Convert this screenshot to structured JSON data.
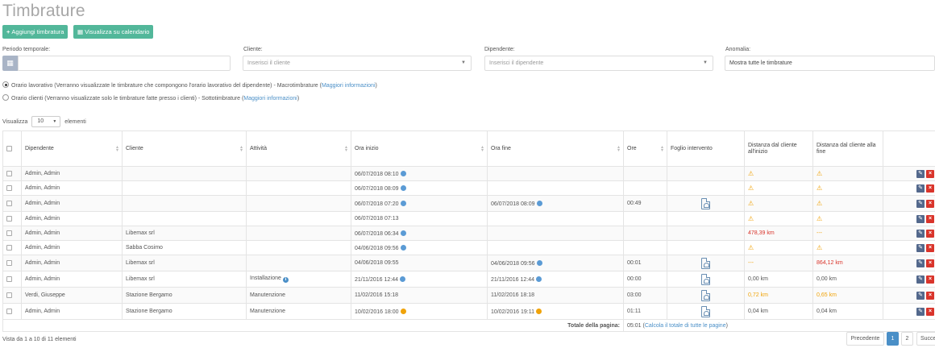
{
  "page": {
    "title": "Timbrature"
  },
  "toolbar": {
    "add_label": "Aggiungi timbratura",
    "calendar_label": "Visualizza su calendario"
  },
  "filters": {
    "period_label": "Periodo temporale:",
    "client_label": "Cliente:",
    "client_placeholder": "Inserisci il cliente",
    "employee_label": "Dipendente:",
    "employee_placeholder": "Inserisci il dipendente",
    "anomaly_label": "Anomalia:",
    "anomaly_value": "Mostra tutte le timbrature"
  },
  "radios": [
    {
      "label": "Orario lavorativo (Verranno visualizzate le timbrature che compongono l'orario lavorativo del dipendente) - Macrotimbrature (",
      "link": "Maggiori informazioni",
      "suffix": ")",
      "checked": true
    },
    {
      "label": "Orario clienti (Verranno visualizzate solo le timbrature fatte presso i clienti) - Sottotimbrature (",
      "link": "Maggiori informazioni",
      "suffix": ")",
      "checked": false
    }
  ],
  "length": {
    "prefix": "Visualizza",
    "value": "10",
    "suffix": "elementi"
  },
  "table": {
    "headers": {
      "employee": "Dipendente",
      "client": "Cliente",
      "activity": "Attività",
      "start": "Ora inizio",
      "end": "Ora fine",
      "hours": "Ore",
      "sheet": "Foglio intervento",
      "dist_start": "Distanza dal cliente all'inizio",
      "dist_end": "Distanza dal cliente alla fine"
    },
    "rows": [
      {
        "employee": "Admin, Admin",
        "client": "",
        "activity": "",
        "start": "06/07/2018 08:10",
        "start_icon": "globe-icon",
        "end": "",
        "end_icon": "",
        "hours": "",
        "pdf": false,
        "dist_start": "",
        "dist_start_kind": "warn",
        "dist_end": "",
        "dist_end_kind": "warn"
      },
      {
        "employee": "Admin, Admin",
        "client": "",
        "activity": "",
        "start": "06/07/2018 08:09",
        "start_icon": "globe-icon",
        "end": "",
        "end_icon": "",
        "hours": "",
        "pdf": false,
        "dist_start": "",
        "dist_start_kind": "warn",
        "dist_end": "",
        "dist_end_kind": "warn"
      },
      {
        "employee": "Admin, Admin",
        "client": "",
        "activity": "",
        "start": "06/07/2018 07:20",
        "start_icon": "globe-icon",
        "end": "06/07/2018 08:09",
        "end_icon": "globe-icon",
        "hours": "00:49",
        "pdf": true,
        "dist_start": "",
        "dist_start_kind": "warn",
        "dist_end": "",
        "dist_end_kind": "warn"
      },
      {
        "employee": "Admin, Admin",
        "client": "",
        "activity": "",
        "start": "06/07/2018 07:13",
        "start_icon": "",
        "end": "",
        "end_icon": "",
        "hours": "",
        "pdf": false,
        "dist_start": "",
        "dist_start_kind": "warn",
        "dist_end": "",
        "dist_end_kind": "warn"
      },
      {
        "employee": "Admin, Admin",
        "client": "Libemax srl",
        "activity": "",
        "start": "06/07/2018 06:34",
        "start_icon": "globe-icon",
        "end": "",
        "end_icon": "",
        "hours": "",
        "pdf": false,
        "dist_start": "478,39 km",
        "dist_start_kind": "red",
        "dist_end": "---",
        "dist_end_kind": "orange"
      },
      {
        "employee": "Admin, Admin",
        "client": "Sabba Cosimo",
        "activity": "",
        "start": "04/06/2018 09:56",
        "start_icon": "globe-icon",
        "end": "",
        "end_icon": "",
        "hours": "",
        "pdf": false,
        "dist_start": "",
        "dist_start_kind": "warn",
        "dist_end": "",
        "dist_end_kind": "warn"
      },
      {
        "employee": "Admin, Admin",
        "client": "Libemax srl",
        "activity": "",
        "start": "04/06/2018 09:55",
        "start_icon": "",
        "end": "04/06/2018 09:56",
        "end_icon": "globe-icon",
        "hours": "00:01",
        "pdf": true,
        "dist_start": "---",
        "dist_start_kind": "orange",
        "dist_end": "864,12 km",
        "dist_end_kind": "red"
      },
      {
        "employee": "Admin, Admin",
        "client": "Libemax srl",
        "activity": "Installazione",
        "activity_icon": "info-icon",
        "start": "21/11/2016 12:44",
        "start_icon": "globe-icon",
        "end": "21/11/2016 12:44",
        "end_icon": "globe-icon",
        "hours": "00:00",
        "pdf": true,
        "dist_start": "0,00 km",
        "dist_start_kind": "plain",
        "dist_end": "0,00 km",
        "dist_end_kind": "plain"
      },
      {
        "employee": "Verdi, Giuseppe",
        "client": "Stazione Bergamo",
        "activity": "Manutenzione",
        "start": "11/02/2016 15:18",
        "start_icon": "",
        "end": "11/02/2016 18:18",
        "end_icon": "",
        "hours": "03:00",
        "pdf": true,
        "dist_start": "0,72 km",
        "dist_start_kind": "orange",
        "dist_end": "0,65 km",
        "dist_end_kind": "orange"
      },
      {
        "employee": "Admin, Admin",
        "client": "Stazione Bergamo",
        "activity": "Manutenzione",
        "start": "10/02/2016 18:00",
        "start_icon": "clock-icon",
        "end": "10/02/2016 19:11",
        "end_icon": "clock-icon",
        "hours": "01:11",
        "pdf": true,
        "dist_start": "0,04 km",
        "dist_start_kind": "plain",
        "dist_end": "0,04 km",
        "dist_end_kind": "plain"
      }
    ],
    "total_label": "Totale della pagina:",
    "total_value": "05:01",
    "total_link": "Calcola il totale di tutte le pagine"
  },
  "footer": {
    "info": "Vista da 1 a 10 di 11 elementi",
    "prev": "Precedente",
    "pages": [
      "1",
      "2"
    ],
    "next": "Successivo"
  },
  "colors": {
    "primary_green": "#52b79a",
    "link_blue": "#4a8fc7",
    "danger_red": "#d9342b",
    "warning_orange": "#f0a30a"
  }
}
